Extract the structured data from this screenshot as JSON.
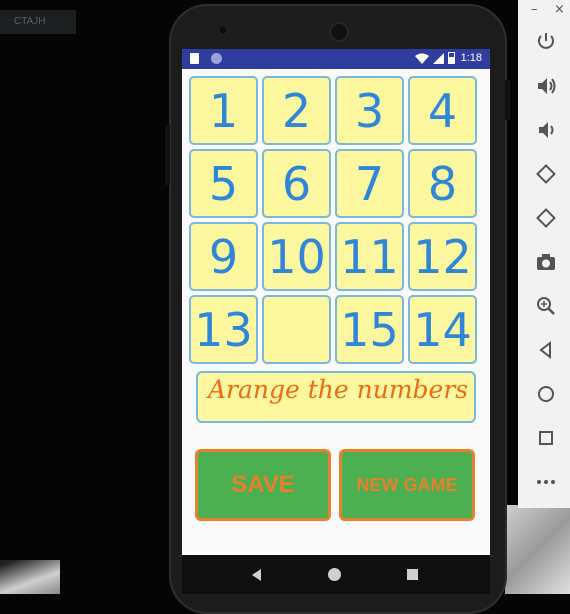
{
  "host": {
    "corner_label": "CTAJH"
  },
  "status_bar": {
    "time": "1:18"
  },
  "puzzle": {
    "tiles": [
      "1",
      "2",
      "3",
      "4",
      "5",
      "6",
      "7",
      "8",
      "9",
      "10",
      "11",
      "12",
      "13",
      "",
      "15",
      "14"
    ]
  },
  "message": "Arange the numbers",
  "buttons": {
    "save": "SAVE",
    "new_game": "NEW GAME"
  },
  "emulator_toolbar": {
    "minimize": "–",
    "close": "×",
    "icons": [
      "power-icon",
      "volume-up-icon",
      "volume-down-icon",
      "rotate-left-icon",
      "rotate-right-icon",
      "camera-icon",
      "zoom-icon",
      "back-icon",
      "home-icon",
      "overview-icon",
      "more-icon"
    ]
  },
  "colors": {
    "tile_bg": "#fdf7a0",
    "tile_border": "#7ab8e0",
    "tile_text": "#2f86d6",
    "message_text": "#ee6b12",
    "button_bg": "#4caf50",
    "button_border": "#e87f2e",
    "status_bar": "#2f3e9e"
  }
}
